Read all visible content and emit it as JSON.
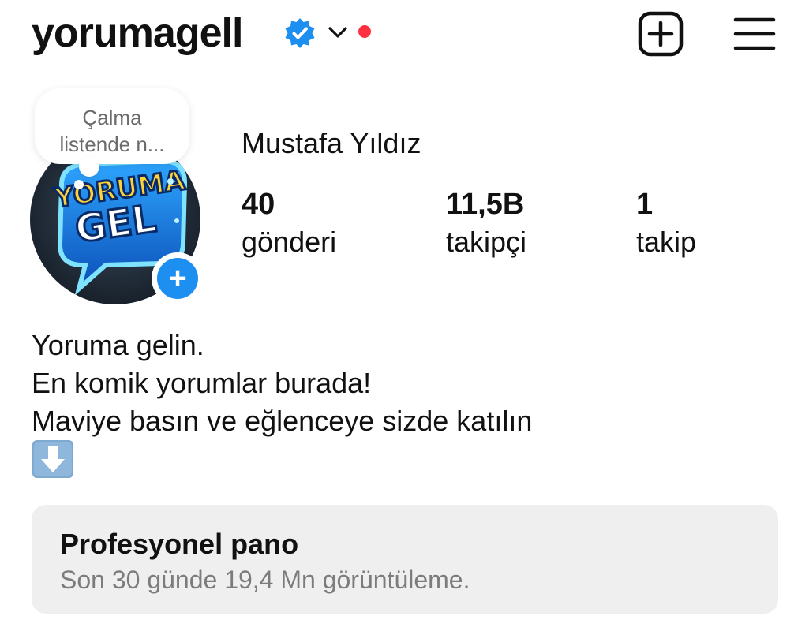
{
  "header": {
    "username": "yorumagell",
    "verified": true,
    "icons": {
      "verified": "verified-badge-icon",
      "dropdown": "chevron-down-icon",
      "notification": "red-dot-icon",
      "create": "plus-square-icon",
      "menu": "hamburger-menu-icon"
    }
  },
  "note": {
    "line1": "Çalma",
    "line2": "listende n..."
  },
  "avatar": {
    "logo_line1": "YORUMA",
    "logo_line2": "GEL",
    "add_icon": "plus-icon"
  },
  "profile": {
    "full_name": "Mustafa Yıldız",
    "stats": [
      {
        "value": "40",
        "label": "gönderi"
      },
      {
        "value": "11,5B",
        "label": "takipçi"
      },
      {
        "value": "1",
        "label": "takip"
      }
    ]
  },
  "bio": {
    "lines": [
      "Yoruma gelin.",
      "En komik yorumlar burada!",
      "Maviye basın ve eğlenceye sizde katılın"
    ],
    "emoji": "down-arrow-emoji"
  },
  "dashboard": {
    "title": "Profesyonel pano",
    "subtitle": "Son 30 günde 19,4 Mn görüntüleme."
  },
  "colors": {
    "accent_blue": "#1d8ff0",
    "notification_red": "#ff3040",
    "card_bg": "#efefef",
    "muted_text": "#7c7c7c"
  }
}
